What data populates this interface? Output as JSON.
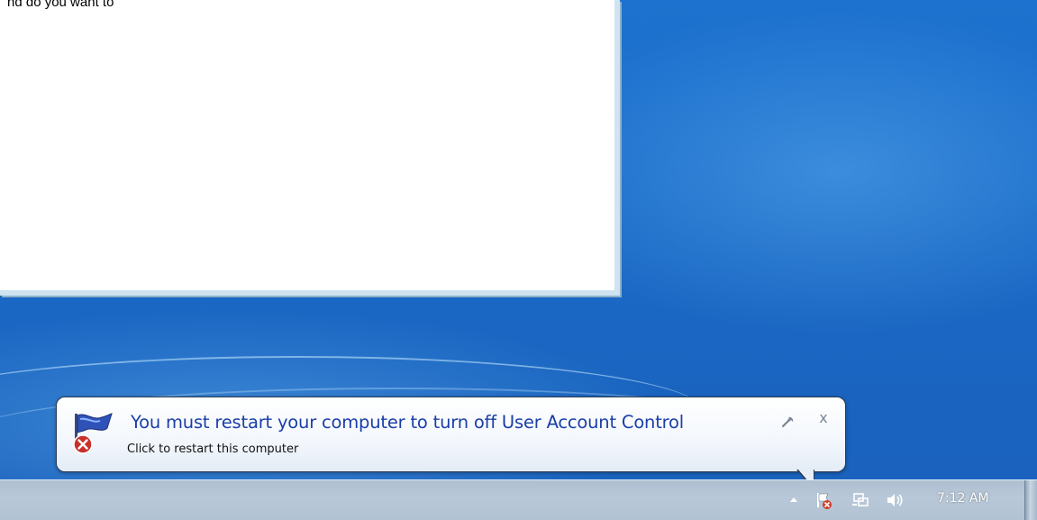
{
  "window": {
    "partial_text": "nd do you want to"
  },
  "balloon": {
    "title": "You must restart your computer to turn off User Account Control",
    "subtitle": "Click to restart this computer",
    "close_glyph": "x"
  },
  "tray": {
    "clock": "7:12 AM",
    "icons": [
      "show-hidden-icons-arrow",
      "action-center-flag-with-error-icon",
      "network-icon",
      "volume-icon"
    ]
  },
  "colors": {
    "desktop_blue": "#1b6cc9",
    "balloon_title": "#1a3fa8",
    "taskbar": "#b9c8d8"
  }
}
